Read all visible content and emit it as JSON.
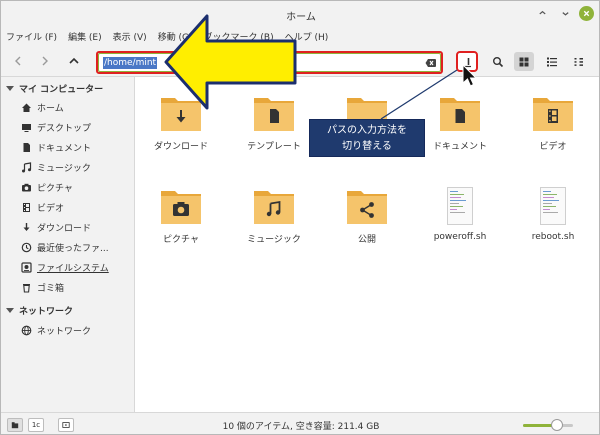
{
  "window": {
    "title": "ホーム"
  },
  "menu": [
    {
      "label": "ファイル (F)"
    },
    {
      "label": "編集 (E)"
    },
    {
      "label": "表示 (V)"
    },
    {
      "label": "移動 (G)"
    },
    {
      "label": "ブックマーク (B)"
    },
    {
      "label": "ヘルプ (H)"
    }
  ],
  "toolbar": {
    "path_value": "/home/mint"
  },
  "sidebar": {
    "sections": [
      {
        "heading": "マイ コンピューター",
        "items": [
          {
            "label": "ホーム",
            "icon": "home-icon"
          },
          {
            "label": "デスクトップ",
            "icon": "desktop-icon"
          },
          {
            "label": "ドキュメント",
            "icon": "document-icon"
          },
          {
            "label": "ミュージック",
            "icon": "music-icon"
          },
          {
            "label": "ピクチャ",
            "icon": "camera-icon"
          },
          {
            "label": "ビデオ",
            "icon": "film-icon"
          },
          {
            "label": "ダウンロード",
            "icon": "download-icon"
          },
          {
            "label": "最近使ったファ...",
            "icon": "recent-icon"
          },
          {
            "label": "ファイルシステム",
            "icon": "drive-icon"
          },
          {
            "label": "ゴミ箱",
            "icon": "trash-icon"
          }
        ]
      },
      {
        "heading": "ネットワーク",
        "items": [
          {
            "label": "ネットワーク",
            "icon": "network-icon"
          }
        ]
      }
    ]
  },
  "files": [
    {
      "label": "ダウンロード",
      "type": "folder",
      "emblem": "download"
    },
    {
      "label": "テンプレート",
      "type": "folder",
      "emblem": "template"
    },
    {
      "label": "",
      "type": "folder",
      "emblem": ""
    },
    {
      "label": "ドキュメント",
      "type": "folder",
      "emblem": "document"
    },
    {
      "label": "ビデオ",
      "type": "folder",
      "emblem": "video"
    },
    {
      "label": "ピクチャ",
      "type": "folder",
      "emblem": "camera"
    },
    {
      "label": "ミュージック",
      "type": "folder",
      "emblem": "music"
    },
    {
      "label": "公開",
      "type": "folder",
      "emblem": "share"
    },
    {
      "label": "poweroff.sh",
      "type": "script"
    },
    {
      "label": "reboot.sh",
      "type": "script"
    }
  ],
  "callout": {
    "line1": "パスの入力方法を",
    "line2": "切り替える"
  },
  "statusbar": {
    "text": "10 個のアイテム, 空き容量: 211.4 GB",
    "btn2_label": "1c",
    "zoom_level": 0.68
  },
  "colors": {
    "accent": "#8fb33a",
    "folder": "#f5c46b",
    "highlight_red": "#e02020",
    "arrow_yellow": "#ffee00",
    "callout_bg": "#1f3a6e"
  }
}
